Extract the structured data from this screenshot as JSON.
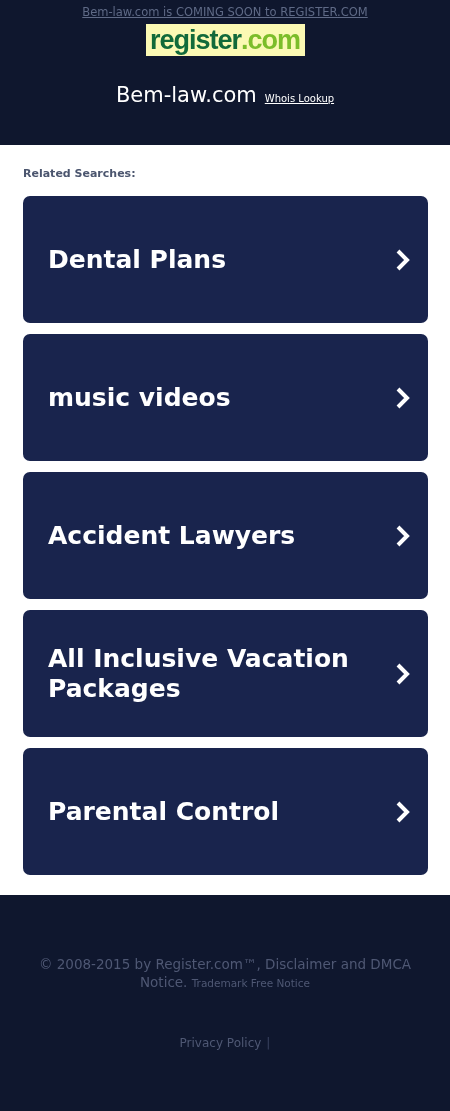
{
  "header": {
    "notice": "Bem-law.com is COMING SOON to REGISTER.COM",
    "logo": {
      "name": "register",
      "tld": ".com"
    },
    "domain": "Bem-law.com",
    "whois_link": "Whois Lookup"
  },
  "related": {
    "heading": "Related Searches:",
    "items": [
      {
        "label": "Dental Plans"
      },
      {
        "label": "music videos"
      },
      {
        "label": "Accident Lawyers"
      },
      {
        "label": "All Inclusive Vacation Packages"
      },
      {
        "label": "Parental Control"
      }
    ]
  },
  "footer": {
    "copyright": "© 2008-2015 by Register.com™, Disclaimer and DMCA Notice.",
    "trademark": "Trademark Free Notice",
    "links": [
      "Privacy Policy"
    ],
    "separator": "|"
  }
}
